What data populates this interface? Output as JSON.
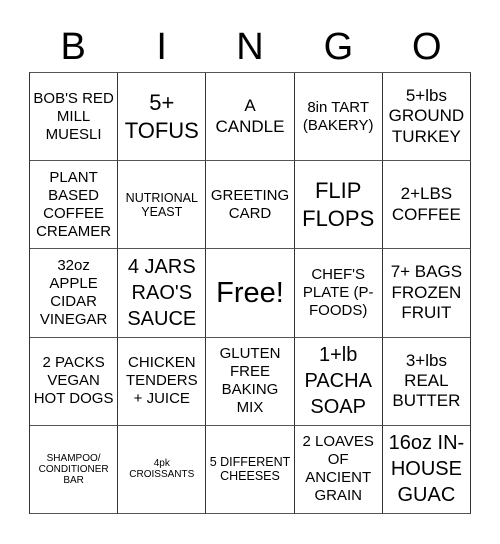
{
  "header": {
    "letters": [
      "B",
      "I",
      "N",
      "G",
      "O"
    ]
  },
  "grid": {
    "rows": [
      [
        {
          "text": "BOB'S RED MILL MUESLI",
          "size": "s-md"
        },
        {
          "text": "5+ TOFUS",
          "size": "s-xxl"
        },
        {
          "text": "A CANDLE",
          "size": "s-lg"
        },
        {
          "text": "8in TART (BAKERY)",
          "size": "s-md"
        },
        {
          "text": "5+lbs GROUND TURKEY",
          "size": "s-lg"
        }
      ],
      [
        {
          "text": "PLANT BASED COFFEE CREAMER",
          "size": "s-md"
        },
        {
          "text": "NUTRIONAL YEAST",
          "size": "s-sm"
        },
        {
          "text": "GREETING CARD",
          "size": "s-md"
        },
        {
          "text": "FLIP FLOPS",
          "size": "s-xxl"
        },
        {
          "text": "2+LBS COFFEE",
          "size": "s-lg"
        }
      ],
      [
        {
          "text": "32oz APPLE CIDAR VINEGAR",
          "size": "s-md"
        },
        {
          "text": "4 JARS RAO'S SAUCE",
          "size": "s-xl"
        },
        {
          "text": "Free!",
          "size": "s-free"
        },
        {
          "text": "CHEF'S PLATE (P-FOODS)",
          "size": "s-md"
        },
        {
          "text": "7+ BAGS FROZEN FRUIT",
          "size": "s-lg"
        }
      ],
      [
        {
          "text": "2 PACKS VEGAN HOT DOGS",
          "size": "s-md"
        },
        {
          "text": "CHICKEN TENDERS + JUICE",
          "size": "s-md"
        },
        {
          "text": "GLUTEN FREE BAKING MIX",
          "size": "s-md"
        },
        {
          "text": "1+lb PACHA SOAP",
          "size": "s-xl"
        },
        {
          "text": "3+lbs REAL BUTTER",
          "size": "s-lg"
        }
      ],
      [
        {
          "text": "SHAMPOO/ CONDITIONER BAR",
          "size": "s-xs"
        },
        {
          "text": "4pk CROISSANTS",
          "size": "s-xs"
        },
        {
          "text": "5 DIFFERENT CHEESES",
          "size": "s-sm"
        },
        {
          "text": "2 LOAVES OF ANCIENT GRAIN",
          "size": "s-md"
        },
        {
          "text": "16oz IN-HOUSE GUAC",
          "size": "s-xl"
        }
      ]
    ]
  }
}
